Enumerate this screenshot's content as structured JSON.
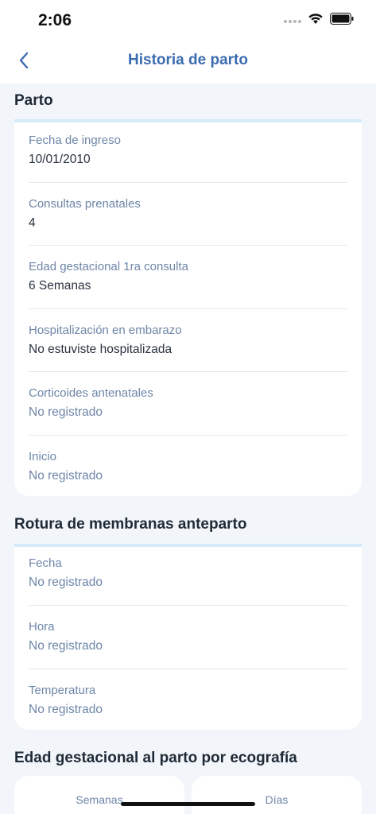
{
  "status_bar": {
    "time": "2:06"
  },
  "header": {
    "title": "Historia de parto"
  },
  "sections": {
    "parto": {
      "title": "Parto",
      "fields": [
        {
          "label": "Fecha de ingreso",
          "value": "10/01/2010"
        },
        {
          "label": "Consultas prenatales",
          "value": "4"
        },
        {
          "label": "Edad gestacional 1ra consulta",
          "value": "6 Semanas"
        },
        {
          "label": "Hospitalización en embarazo",
          "value": "No estuviste hospitalizada"
        },
        {
          "label": "Corticoides antenatales",
          "value": "No registrado"
        },
        {
          "label": "Inicio",
          "value": "No registrado"
        }
      ]
    },
    "rotura": {
      "title": "Rotura de membranas anteparto",
      "fields": [
        {
          "label": "Fecha",
          "value": "No registrado"
        },
        {
          "label": "Hora",
          "value": "No registrado"
        },
        {
          "label": "Temperatura",
          "value": "No registrado"
        }
      ]
    },
    "edad_gestacional": {
      "title": "Edad gestacional al parto por ecografía",
      "semanas_label": "Semanas",
      "dias_label": "Días"
    }
  },
  "colors": {
    "accent": "#3b6cb0",
    "label": "#6e86a8",
    "card_top": "#d5ebf8",
    "background": "#f2f5f9"
  },
  "icons": [
    "back-chevron-icon",
    "signal-dots-icon",
    "wifi-icon",
    "battery-icon"
  ]
}
